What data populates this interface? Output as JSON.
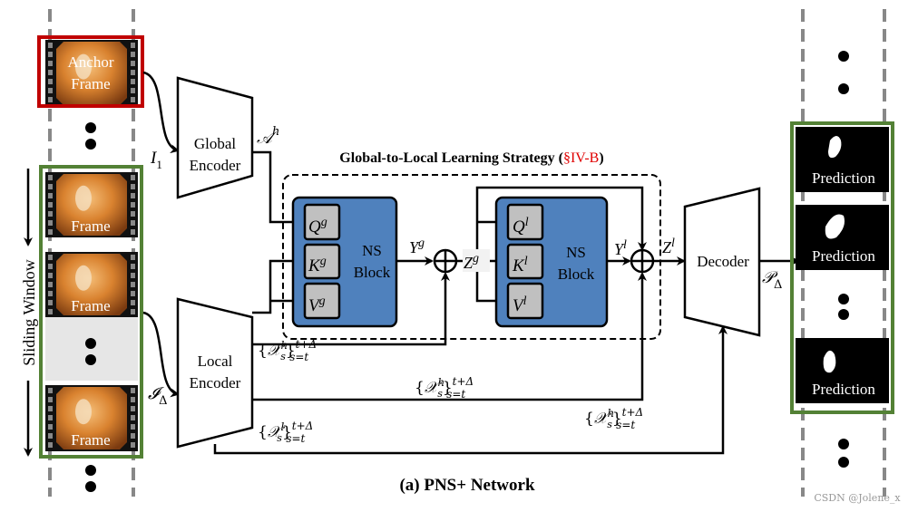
{
  "caption": "(a) PNS+ Network",
  "watermark": "CSDN @Jolene_x",
  "colors": {
    "anchor_border": "#c00000",
    "window_border": "#538135",
    "ns_block": "#4f81bd",
    "qkv_box": "#c0c0c0",
    "section_ref": "#e00000"
  },
  "input_strip": {
    "anchor_frame": [
      "Anchor",
      "Frame"
    ],
    "frame_label": "Frame",
    "sliding_window": "Sliding Window"
  },
  "global_encoder": {
    "lines": [
      "Global",
      "Encoder"
    ],
    "input": "I",
    "input_sub": "1",
    "output": "𝒜",
    "output_sup": "h"
  },
  "local_encoder": {
    "lines": [
      "Local",
      "Encoder"
    ],
    "input": "𝓘",
    "input_sub": "Δ"
  },
  "strategy": {
    "title": "Global-to-Local Learning Strategy (",
    "ref": "§IV-B",
    "close": ")"
  },
  "ns_global": {
    "lines": [
      "NS",
      "Block"
    ],
    "q": "Q",
    "k": "K",
    "v": "V",
    "sup": "g",
    "out": "Y",
    "out_sup": "g",
    "z": "Z",
    "z_sup": "g"
  },
  "ns_local": {
    "lines": [
      "NS",
      "Block"
    ],
    "q": "Q",
    "k": "K",
    "v": "V",
    "sup": "l",
    "out": "Y",
    "out_sup": "l",
    "z": "Z",
    "z_sup": "l"
  },
  "features": {
    "open": "{",
    "x": "𝒳",
    "s": "s",
    "h": "h",
    "l": "l",
    "close": "}",
    "upper": "t+Δ",
    "lower": "s=t"
  },
  "decoder": {
    "label": "Decoder",
    "output": "𝒫",
    "output_sub": "Δ"
  },
  "prediction_label": "Prediction"
}
